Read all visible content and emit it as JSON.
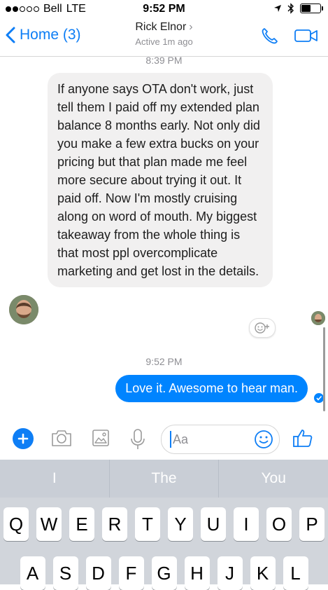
{
  "status_bar": {
    "carrier": "Bell",
    "network": "LTE",
    "time": "9:52 PM",
    "signal_bars": 2,
    "battery_level": 0.45
  },
  "nav": {
    "back_label": "Home (3)",
    "contact_name": "Rick Elnor",
    "contact_status": "Active 1m ago",
    "accent_color": "#0e7ef5"
  },
  "chat": {
    "timestamp_top": "8:39 PM",
    "incoming_message": "If anyone says OTA don't work, just tell them I paid off my extended plan balance 8 months early. Not only did you make a few extra bucks on your pricing but that plan made me feel more secure about trying it out. It paid off. Now I'm mostly cruising along on word of mouth. My biggest takeaway from the whole thing is that most ppl overcomplicate marketing and get lost in the details.",
    "timestamp_mid": "9:52 PM",
    "outgoing_message": "Love it. Awesome to hear man.",
    "outgoing_color": "#0084ff"
  },
  "composer": {
    "placeholder": "Aa",
    "icons": [
      "plus-icon",
      "camera-icon",
      "image-icon",
      "microphone-icon",
      "emoji-icon",
      "thumbs-up-icon"
    ]
  },
  "keyboard": {
    "suggestions": [
      "I",
      "The",
      "You"
    ],
    "row1": [
      "Q",
      "W",
      "E",
      "R",
      "T",
      "Y",
      "U",
      "I",
      "O",
      "P"
    ],
    "row2": [
      "A",
      "S",
      "D",
      "F",
      "G",
      "H",
      "J",
      "K",
      "L"
    ]
  }
}
